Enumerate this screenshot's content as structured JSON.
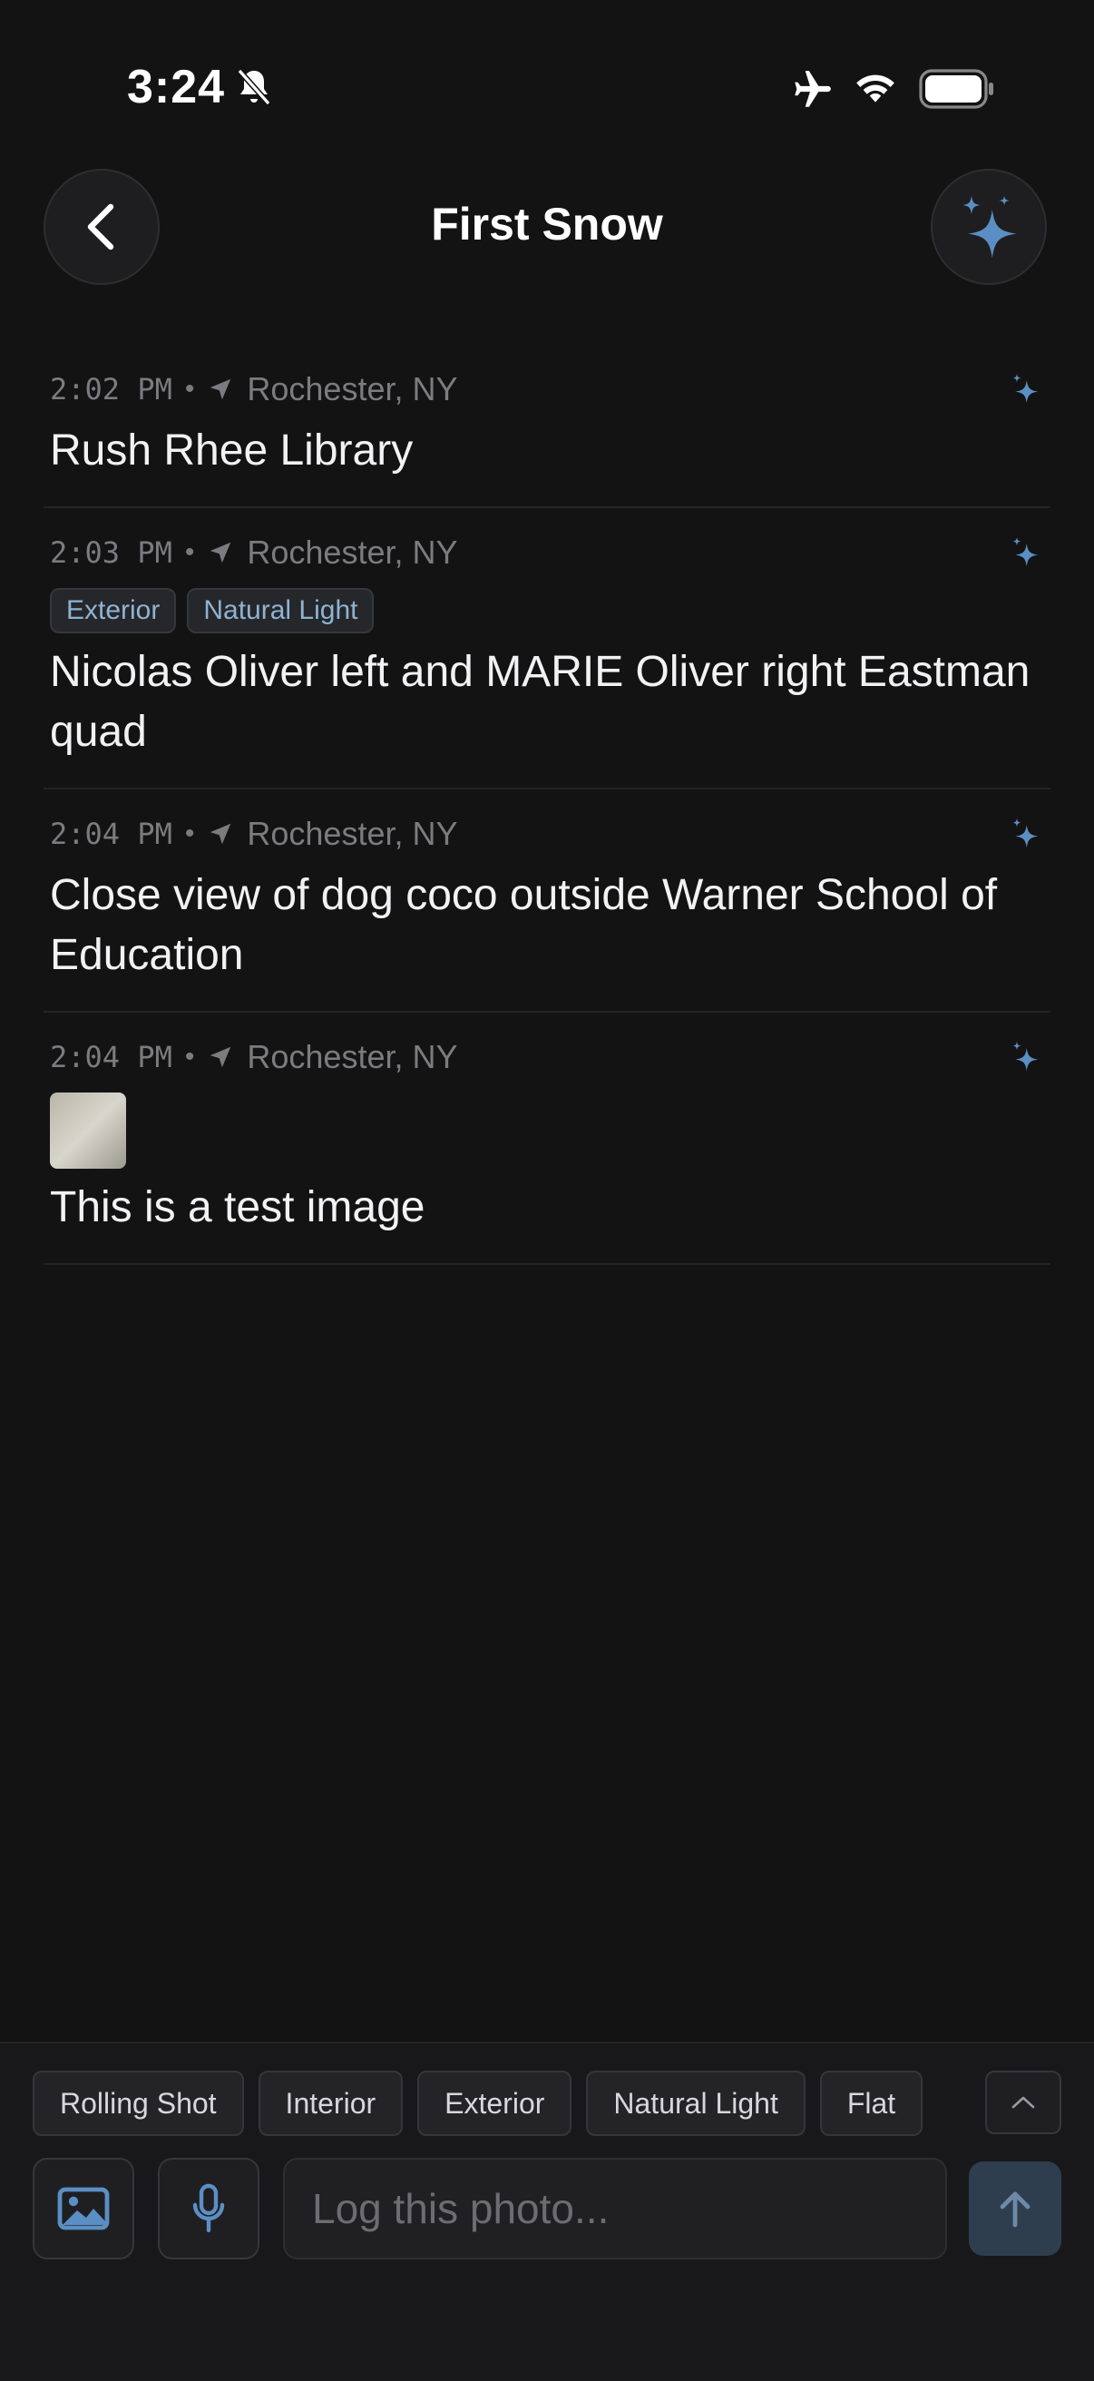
{
  "status_bar": {
    "time": "3:24"
  },
  "header": {
    "title": "First Snow"
  },
  "entries": [
    {
      "time": "2:02 PM",
      "separator": "•",
      "location": "Rochester, NY",
      "tags": [],
      "text": "Rush Rhee Library"
    },
    {
      "time": "2:03 PM",
      "separator": "•",
      "location": "Rochester, NY",
      "tags": [
        "Exterior",
        "Natural Light"
      ],
      "text": "Nicolas Oliver left and MARIE Oliver right Eastman quad"
    },
    {
      "time": "2:04 PM",
      "separator": "•",
      "location": "Rochester, NY",
      "tags": [],
      "text": "Close view of dog coco outside Warner School of Education"
    },
    {
      "time": "2:04 PM",
      "separator": "•",
      "location": "Rochester, NY",
      "tags": [],
      "text": "This is a test image"
    }
  ],
  "composer": {
    "chips": [
      "Rolling Shot",
      "Interior",
      "Exterior",
      "Natural Light",
      "Flat"
    ],
    "placeholder": "Log this photo..."
  },
  "colors": {
    "accent": "#5b8fc4",
    "background": "#131314",
    "send_button": "#2f3e4e"
  }
}
